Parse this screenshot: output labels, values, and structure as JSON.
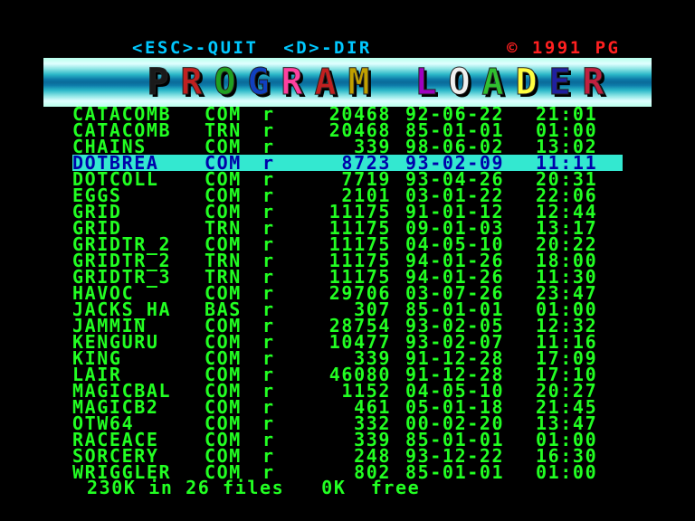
{
  "header": {
    "left": "<ESC>-QUIT  <D>-DIR",
    "right": "© 1991 PG"
  },
  "banner": {
    "title": "PROGRAM LOADER",
    "letter_colors": [
      "#1a1a1a",
      "#c02020",
      "#20a020",
      "#1040c0",
      "#ff40a0",
      "#c02020",
      "#c0a000",
      "#a000c0",
      "#f0f0f0",
      "#30c030",
      "#ffff40",
      "#2020a0",
      "#c02040",
      "#c0c0c0"
    ]
  },
  "files": [
    {
      "name": "CATACOMB",
      "ext": "COM",
      "attr": "r",
      "size": "20468",
      "date": "92-06-22",
      "time": "21:01"
    },
    {
      "name": "CATACOMB",
      "ext": "TRN",
      "attr": "r",
      "size": "20468",
      "date": "85-01-01",
      "time": "01:00"
    },
    {
      "name": "CHAINS",
      "ext": "COM",
      "attr": "r",
      "size": "339",
      "date": "98-06-02",
      "time": "13:02"
    },
    {
      "name": "DOTBREA",
      "ext": "COM",
      "attr": "r",
      "size": "8723",
      "date": "93-02-09",
      "time": "11:11",
      "selected": true
    },
    {
      "name": "DOTCOLL",
      "ext": "COM",
      "attr": "r",
      "size": "7719",
      "date": "93-04-26",
      "time": "20:31"
    },
    {
      "name": "EGGS",
      "ext": "COM",
      "attr": "r",
      "size": "2101",
      "date": "03-01-22",
      "time": "22:06"
    },
    {
      "name": "GRID",
      "ext": "COM",
      "attr": "r",
      "size": "11175",
      "date": "91-01-12",
      "time": "12:44"
    },
    {
      "name": "GRID",
      "ext": "TRN",
      "attr": "r",
      "size": "11175",
      "date": "09-01-03",
      "time": "13:17"
    },
    {
      "name": "GRIDTR_2",
      "ext": "COM",
      "attr": "r",
      "size": "11175",
      "date": "04-05-10",
      "time": "20:22"
    },
    {
      "name": "GRIDTR_2",
      "ext": "TRN",
      "attr": "r",
      "size": "11175",
      "date": "94-01-26",
      "time": "18:00"
    },
    {
      "name": "GRIDTR_3",
      "ext": "TRN",
      "attr": "r",
      "size": "11175",
      "date": "94-01-26",
      "time": "11:30"
    },
    {
      "name": "HAVOC",
      "ext": "COM",
      "attr": "r",
      "size": "29706",
      "date": "03-07-26",
      "time": "23:47"
    },
    {
      "name": "JACKS_HA",
      "ext": "BAS",
      "attr": "r",
      "size": "307",
      "date": "85-01-01",
      "time": "01:00"
    },
    {
      "name": "JAMMIN",
      "ext": "COM",
      "attr": "r",
      "size": "28754",
      "date": "93-02-05",
      "time": "12:32"
    },
    {
      "name": "KENGURU",
      "ext": "COM",
      "attr": "r",
      "size": "10477",
      "date": "93-02-07",
      "time": "11:16"
    },
    {
      "name": "KING",
      "ext": "COM",
      "attr": "r",
      "size": "339",
      "date": "91-12-28",
      "time": "17:09"
    },
    {
      "name": "LAIR",
      "ext": "COM",
      "attr": "r",
      "size": "46080",
      "date": "91-12-28",
      "time": "17:10"
    },
    {
      "name": "MAGICBAL",
      "ext": "COM",
      "attr": "r",
      "size": "1152",
      "date": "04-05-10",
      "time": "20:27"
    },
    {
      "name": "MAGICB2",
      "ext": "COM",
      "attr": "r",
      "size": "461",
      "date": "05-01-18",
      "time": "21:45"
    },
    {
      "name": "OTW64",
      "ext": "COM",
      "attr": "r",
      "size": "332",
      "date": "00-02-20",
      "time": "13:47"
    },
    {
      "name": "RACEACE",
      "ext": "COM",
      "attr": "r",
      "size": "339",
      "date": "85-01-01",
      "time": "01:00"
    },
    {
      "name": "SORCERY",
      "ext": "COM",
      "attr": "r",
      "size": "248",
      "date": "93-12-22",
      "time": "16:30"
    },
    {
      "name": "WRIGGLER",
      "ext": "COM",
      "attr": "r",
      "size": "802",
      "date": "85-01-01",
      "time": "01:00"
    }
  ],
  "footer": "230K in 26 files   0K  free",
  "colors": {
    "list_text": "#22ff22",
    "selection_bg": "#33e8d0",
    "selection_text": "#0000aa",
    "header_keys": "#00c8ff",
    "copyright": "#ff2020"
  }
}
